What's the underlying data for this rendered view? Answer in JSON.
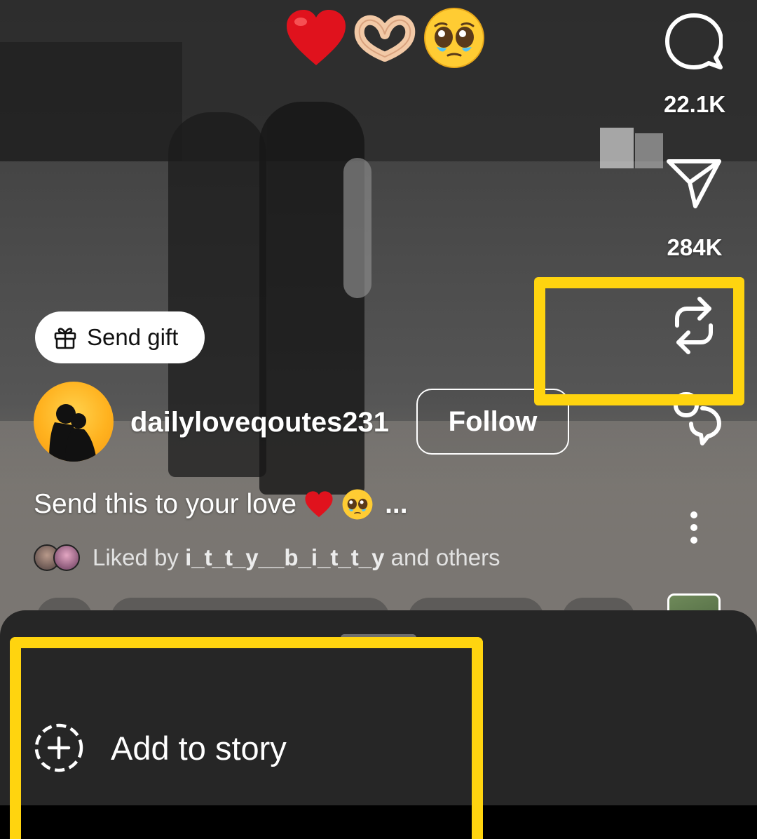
{
  "reel": {
    "caption_emojis": [
      "red-heart",
      "heart-hands",
      "pleading-face"
    ],
    "send_gift_label": "Send gift",
    "author": {
      "username": "dailyloveqoutes231",
      "follow_label": "Follow"
    },
    "caption": {
      "text": "Send this to your love",
      "more": "..."
    },
    "liked_by": {
      "prefix": "Liked by",
      "user": "i_t_t_y__b_i_t_t_y",
      "suffix": "and others"
    }
  },
  "actions": {
    "comments": {
      "icon": "comment-icon",
      "count": "22.1K"
    },
    "share": {
      "icon": "paper-plane-icon",
      "count": "284K"
    },
    "repost": {
      "icon": "repost-icon"
    },
    "remix": {
      "icon": "remix-icon"
    },
    "more": {
      "icon": "more-vertical-icon"
    }
  },
  "sheet": {
    "add_to_story_label": "Add to story",
    "add_to_story_icon": "add-story-icon"
  },
  "colors": {
    "highlight": "#ffd40f",
    "sheet_bg": "#262626",
    "follow_border": "#ffffff"
  }
}
